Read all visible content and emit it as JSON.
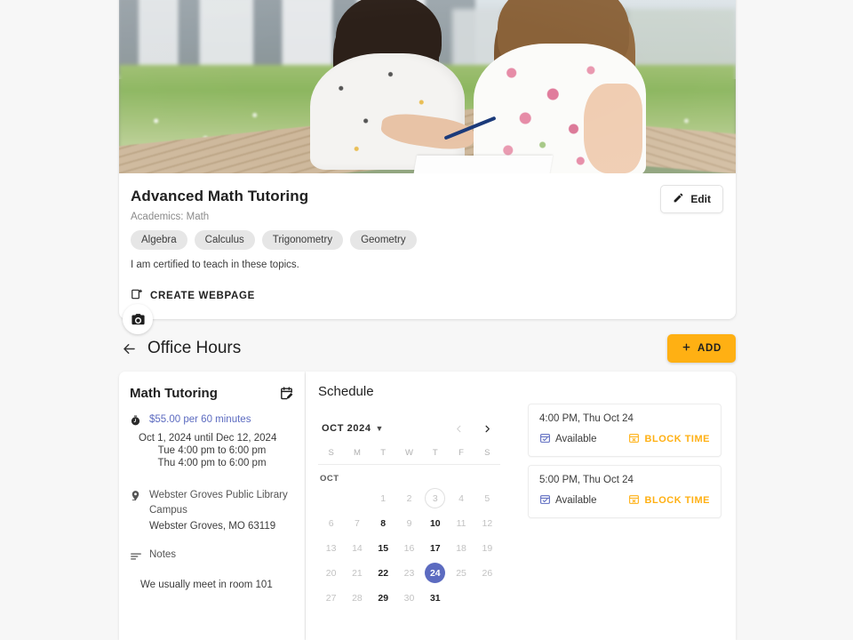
{
  "profile": {
    "hero_alt": "two-students-studying-outdoors-photo",
    "camera_icon": "camera-icon",
    "title": "Advanced Math Tutoring",
    "subject": "Academics: Math",
    "chips": [
      "Algebra",
      "Calculus",
      "Trigonometry",
      "Geometry"
    ],
    "description": "I am certified to teach in these topics.",
    "create_webpage_label": "CREATE WEBPAGE",
    "create_webpage_icon": "new-page-icon",
    "edit_label": "Edit",
    "edit_icon": "pencil-icon"
  },
  "section": {
    "back_icon": "arrow-left-icon",
    "title": "Office Hours",
    "add_label": "ADD",
    "add_icon": "plus-icon",
    "add_color": "#ffb013"
  },
  "details": {
    "title": "Math Tutoring",
    "edit_icon": "calendar-edit-icon",
    "price_icon": "stopwatch-icon",
    "price": "$55.00 per 60 minutes",
    "price_color": "#5c6bc0",
    "date_range": "Oct 1, 2024 until Dec 12, 2024",
    "times": [
      "Tue 4:00 pm to 6:00 pm",
      "Thu 4:00 pm to 6:00 pm"
    ],
    "location_icon": "map-pin-icon",
    "location_name": "Webster Groves Public Library Campus",
    "location_address": "Webster Groves, MO 63119",
    "notes_icon": "notes-icon",
    "notes_label": "Notes",
    "notes_text": "We usually meet in room 101"
  },
  "schedule": {
    "title": "Schedule",
    "calendar": {
      "month_label": "OCT 2024",
      "caret_icon": "chevron-down-icon",
      "prev_icon": "chevron-left-icon",
      "next_icon": "chevron-right-icon",
      "prev_enabled": false,
      "next_enabled": true,
      "dow": [
        "S",
        "M",
        "T",
        "W",
        "T",
        "F",
        "S"
      ],
      "month_short": "OCT",
      "selected_day": 24,
      "selected_color": "#5c6bc0",
      "today_day": 3,
      "enabled_days": [
        8,
        10,
        15,
        17,
        22,
        24,
        29,
        31
      ],
      "leading_blanks": 2,
      "days": [
        1,
        2,
        3,
        4,
        5,
        6,
        7,
        8,
        9,
        10,
        11,
        12,
        13,
        14,
        15,
        16,
        17,
        18,
        19,
        20,
        21,
        22,
        23,
        24,
        25,
        26,
        27,
        28,
        29,
        30,
        31
      ]
    },
    "slots": [
      {
        "time": "4:00 PM, Thu Oct 24",
        "status": "Available",
        "status_icon": "calendar-check-icon",
        "action": "BLOCK TIME",
        "action_icon": "calendar-x-icon",
        "action_color": "#ffb013"
      },
      {
        "time": "5:00 PM, Thu Oct 24",
        "status": "Available",
        "status_icon": "calendar-check-icon",
        "action": "BLOCK TIME",
        "action_icon": "calendar-x-icon",
        "action_color": "#ffb013"
      }
    ]
  }
}
